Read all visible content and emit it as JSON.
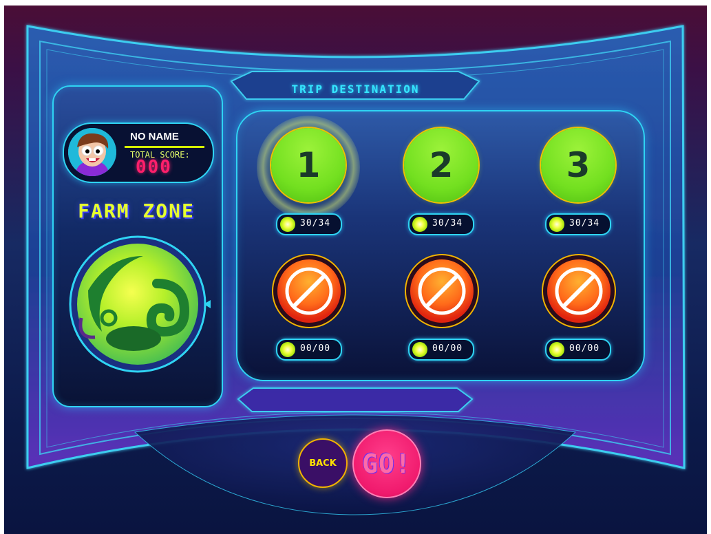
{
  "screen": {
    "title": "TRIP DESTINATION",
    "accent_color": "#2fd4f3",
    "background_color": "#172a63"
  },
  "player": {
    "name": "NO NAME",
    "score_label": "TOTAL SCORE:",
    "score_value": "000"
  },
  "zone": {
    "name": "FARM ZONE",
    "image_icon": "farm-planet-icon"
  },
  "levels": [
    {
      "label": "1",
      "progress": "30/34",
      "state": "unlocked",
      "selected": true
    },
    {
      "label": "2",
      "progress": "30/34",
      "state": "unlocked",
      "selected": false
    },
    {
      "label": "3",
      "progress": "30/34",
      "state": "unlocked",
      "selected": false
    },
    {
      "label": "",
      "progress": "00/00",
      "state": "locked",
      "icon": "no-entry-icon"
    },
    {
      "label": "",
      "progress": "00/00",
      "state": "locked",
      "icon": "no-entry-icon"
    },
    {
      "label": "",
      "progress": "00/00",
      "state": "locked",
      "icon": "no-entry-icon"
    }
  ],
  "buttons": {
    "back_label": "BACK",
    "go_label": "GO!"
  }
}
